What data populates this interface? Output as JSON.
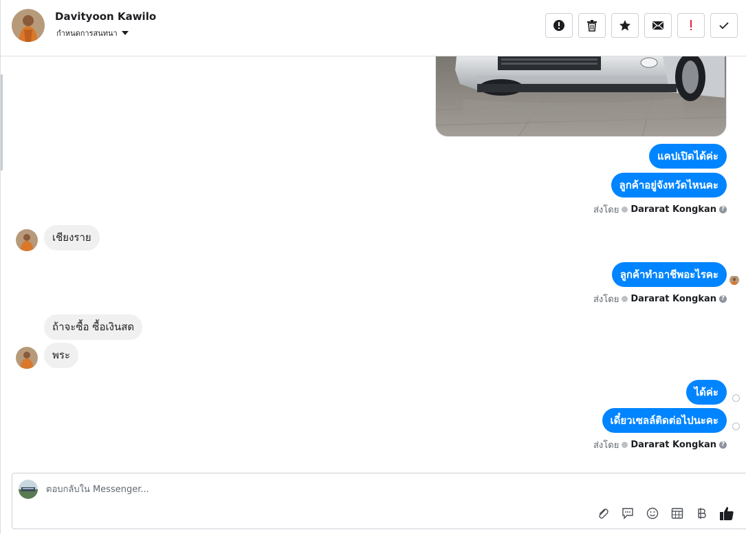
{
  "header": {
    "contact_name": "Davityoon Kawilo",
    "subtitle": "กำหนดการสนทนา",
    "toolbar": [
      {
        "name": "spam-button",
        "icon": "info-exclamation-icon"
      },
      {
        "name": "delete-button",
        "icon": "trash-icon"
      },
      {
        "name": "star-button",
        "icon": "star-icon"
      },
      {
        "name": "mark-unread-button",
        "icon": "envelope-icon"
      },
      {
        "name": "follow-up-button",
        "icon": "red-exclamation-icon"
      },
      {
        "name": "mark-done-button",
        "icon": "check-icon"
      }
    ]
  },
  "messages": {
    "out1": "แคปเปิดได้ค่ะ",
    "out2": "ลูกค้าอยู่จังหวัดไหนคะ",
    "in1": "เชียงราย",
    "out3": "ลูกค้าทำอาชีพอะไรคะ",
    "in2": "ถ้าจะซื้อ ซื้อเงินสด",
    "in3": "พระ",
    "out4": "ได้ค่ะ",
    "out5": "เดี๋ยวเซลล์ติดต่อไปนะคะ"
  },
  "sent_by": {
    "label": "ส่งโดย",
    "agent": "Dararat Kongkan"
  },
  "composer": {
    "placeholder": "ตอบกลับใน Messenger...",
    "value": ""
  },
  "colors": {
    "outgoing_bubble": "#0084ff",
    "incoming_bubble": "#f0f0f0",
    "follow_up": "#e41e3f"
  }
}
